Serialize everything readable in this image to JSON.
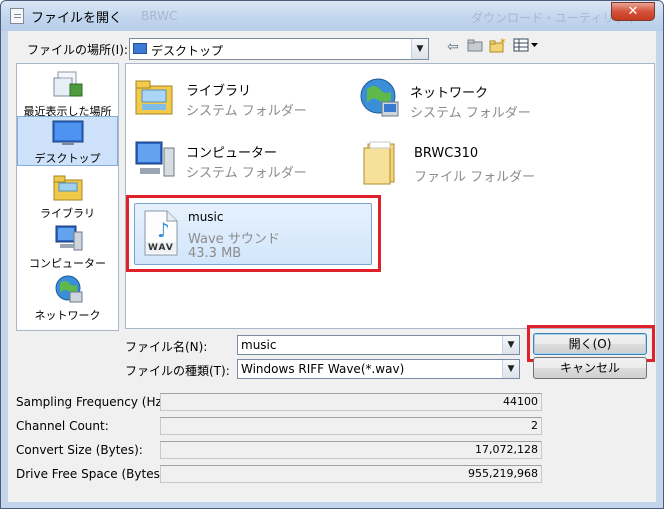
{
  "window": {
    "title": "ファイルを開く",
    "ghost_texts": [
      "BRWC",
      "ダウンロード・ユーティリティ"
    ],
    "close_glyph": "✕"
  },
  "location": {
    "label": "ファイルの場所(I):",
    "value": "デスクトップ",
    "toolbar_icons": [
      "back-arrow-icon",
      "up-folder-icon",
      "new-folder-icon",
      "view-menu-icon"
    ]
  },
  "places": [
    {
      "label": "最近表示した場所",
      "icon": "recent-places-icon"
    },
    {
      "label": "デスクトップ",
      "icon": "desktop-icon",
      "selected": true
    },
    {
      "label": "ライブラリ",
      "icon": "library-icon"
    },
    {
      "label": "コンピューター",
      "icon": "computer-icon"
    },
    {
      "label": "ネットワーク",
      "icon": "network-icon"
    }
  ],
  "files": [
    {
      "name": "ライブラリ",
      "type": "システム フォルダー",
      "icon": "library-icon"
    },
    {
      "name": "ネットワーク",
      "type": "システム フォルダー",
      "icon": "network-icon"
    },
    {
      "name": "コンピューター",
      "type": "システム フォルダー",
      "icon": "computer-icon"
    },
    {
      "name": "BRWC310",
      "type": "ファイル フォルダー",
      "icon": "folder-icon"
    },
    {
      "name": "music",
      "type": "Wave サウンド",
      "size": "43.3 MB",
      "icon": "wav-file-icon",
      "badge": "WAV",
      "selected": true
    }
  ],
  "filename": {
    "label": "ファイル名(N):",
    "value": "music"
  },
  "filetype": {
    "label": "ファイルの種類(T):",
    "value": "Windows RIFF Wave(*.wav)"
  },
  "buttons": {
    "open": "開く(O)",
    "cancel": "キャンセル"
  },
  "stats": [
    {
      "label": "Sampling Frequency (Hz):",
      "value": "44100"
    },
    {
      "label": "Channel Count:",
      "value": "2"
    },
    {
      "label": "Convert Size (Bytes):",
      "value": "17,072,128"
    },
    {
      "label": "Drive Free Space (Bytes):",
      "value": "955,219,968"
    }
  ],
  "colors": {
    "highlight_box": "#e0202a",
    "selection": "#cde2fa"
  }
}
